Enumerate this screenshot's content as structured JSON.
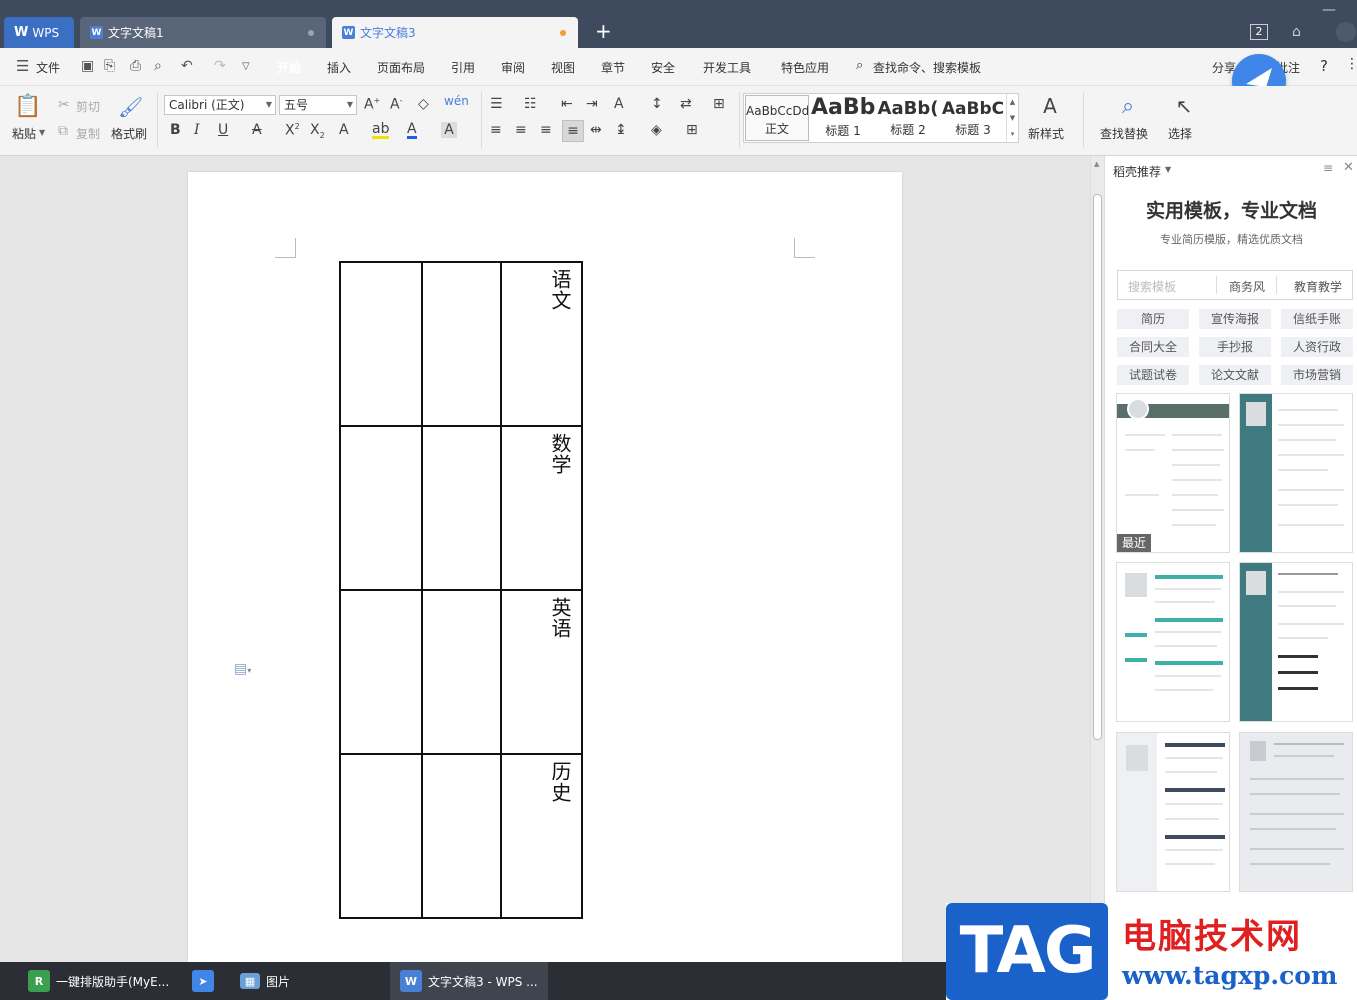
{
  "titlebar": {
    "wps_label": "WPS",
    "tabs": [
      {
        "label": "文字文稿1"
      },
      {
        "label": "文字文稿3"
      }
    ],
    "new_tab": "+",
    "badge": "2"
  },
  "menubar": {
    "file": "文件",
    "items": [
      "开始",
      "插入",
      "页面布局",
      "引用",
      "审阅",
      "视图",
      "章节",
      "安全",
      "开发工具",
      "特色应用"
    ],
    "search": "查找命令、搜索模板",
    "share": "分享",
    "right_item": "批注",
    "help": "?"
  },
  "ribbon": {
    "paste": "粘贴",
    "cut": "剪切",
    "copy": "复制",
    "format_painter": "格式刷",
    "font_name": "Calibri (正文)",
    "font_size": "五号",
    "styles": [
      {
        "preview": "AaBbCcDd",
        "name": "正文"
      },
      {
        "preview": "AaBb",
        "name": "标题 1"
      },
      {
        "preview": "AaBb(",
        "name": "标题 2"
      },
      {
        "preview": "AaBbC",
        "name": "标题 3"
      }
    ],
    "new_style": "新样式",
    "find_replace": "查找替换",
    "select": "选择"
  },
  "document": {
    "table_rows": [
      {
        "label": "语文"
      },
      {
        "label": "数学"
      },
      {
        "label": "英语"
      },
      {
        "label": "历史"
      }
    ]
  },
  "side_panel": {
    "header": "稻壳推荐",
    "title": "实用模板，专业文档",
    "subtitle": "专业简历模版，精选优质文档",
    "search_placeholder": "搜索模板",
    "tags_top": [
      "商务风",
      "教育教学"
    ],
    "categories": [
      "简历",
      "宣传海报",
      "信纸手账",
      "合同大全",
      "手抄报",
      "人资行政",
      "试题试卷",
      "论文文献",
      "市场营销"
    ],
    "recent_badge": "最近"
  },
  "taskbar": {
    "items": [
      {
        "label": "一键排版助手(MyE..."
      },
      {
        "label": ""
      },
      {
        "label": "图片"
      },
      {
        "label": "文字文稿3 - WPS ..."
      }
    ]
  },
  "watermark": {
    "tag": "TAG",
    "site_name": "电脑技术网",
    "url": "www.tagxp.com"
  },
  "colors": {
    "titlebar": "#3e4b5e",
    "accent": "#4a7fd6",
    "active_menu": "#4a7fd6",
    "taskbar": "#2b2f35",
    "watermark_blue": "#1a62c9",
    "watermark_red": "#e02020"
  }
}
